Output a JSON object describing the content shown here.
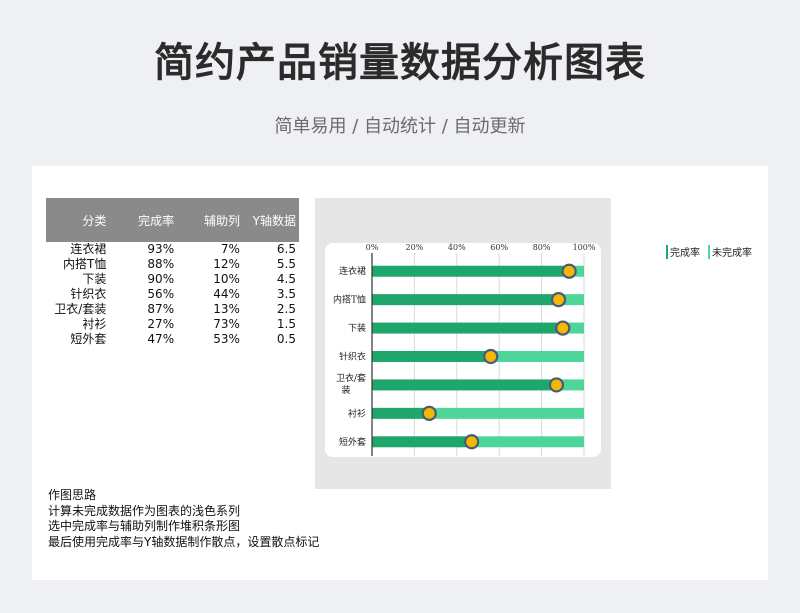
{
  "title": "简约产品销量数据分析图表",
  "subtitle": "简单易用 / 自动统计 / 自动更新",
  "table": {
    "headers": [
      "分类",
      "完成率",
      "辅助列",
      "Y轴数据"
    ],
    "rows": [
      [
        "连衣裙",
        "93%",
        "7%",
        "6.5"
      ],
      [
        "内搭T恤",
        "88%",
        "12%",
        "5.5"
      ],
      [
        "下装",
        "90%",
        "10%",
        "4.5"
      ],
      [
        "针织衣",
        "56%",
        "44%",
        "3.5"
      ],
      [
        "卫衣/套装",
        "87%",
        "13%",
        "2.5"
      ],
      [
        "衬衫",
        "27%",
        "73%",
        "1.5"
      ],
      [
        "短外套",
        "47%",
        "53%",
        "0.5"
      ]
    ]
  },
  "notes": {
    "heading": "作图思路",
    "lines": [
      "计算未完成数据作为图表的浅色系列",
      "选中完成率与辅助列制作堆积条形图",
      "最后使用完成率与Y轴数据制作散点，设置散点标记"
    ]
  },
  "legend": {
    "completed": "完成率",
    "remaining": "未完成率"
  },
  "colors": {
    "completed": "#1fa66a",
    "remaining": "#4dd59a",
    "marker_fill": "#f5b800",
    "marker_stroke": "#4a5a78"
  },
  "chart_data": {
    "type": "bar",
    "orientation": "horizontal",
    "stacked": true,
    "categories": [
      "连衣裙",
      "内搭T恤",
      "下装",
      "针织衣",
      "卫衣/套装",
      "衬衫",
      "短外套"
    ],
    "category_labels": [
      "连衣裙",
      "内搭T恤",
      "下装",
      "针织衣",
      [
        "卫衣/套",
        "装"
      ],
      "衬衫",
      "短外套"
    ],
    "series": [
      {
        "name": "完成率",
        "values": [
          93,
          88,
          90,
          56,
          87,
          27,
          47
        ]
      },
      {
        "name": "未完成率",
        "values": [
          7,
          12,
          10,
          44,
          13,
          73,
          53
        ]
      }
    ],
    "scatter": {
      "x": [
        93,
        88,
        90,
        56,
        87,
        27,
        47
      ],
      "y": [
        6.5,
        5.5,
        4.5,
        3.5,
        2.5,
        1.5,
        0.5
      ]
    },
    "x_ticks": [
      "0%",
      "20%",
      "40%",
      "60%",
      "80%",
      "100%"
    ],
    "xlim": [
      0,
      100
    ],
    "ylim": [
      0,
      7
    ],
    "grid": true,
    "legend_position": "right"
  }
}
